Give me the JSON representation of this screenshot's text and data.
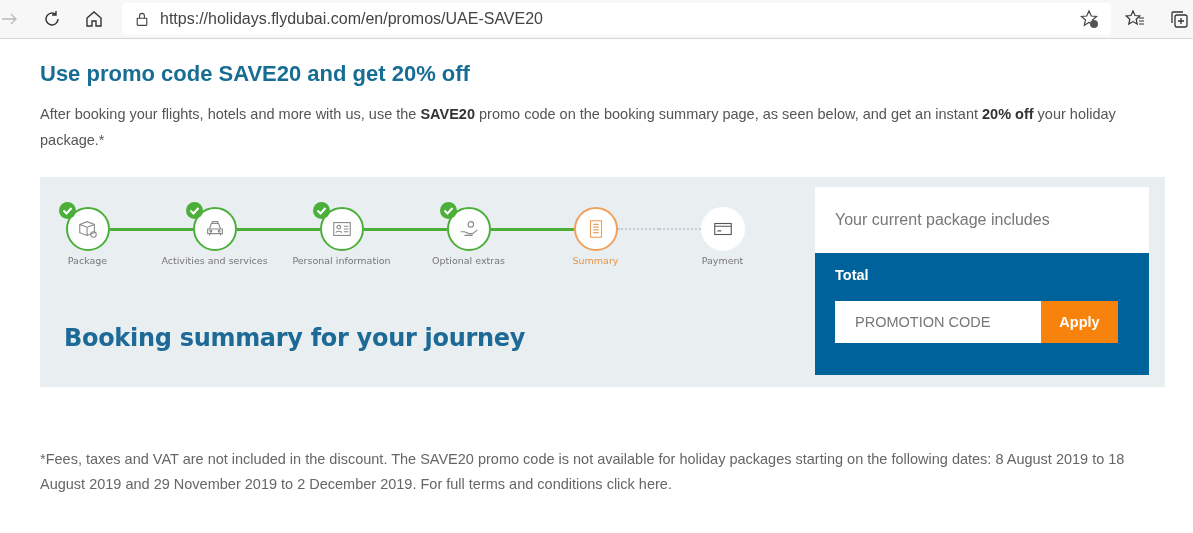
{
  "browser": {
    "url": "https://holidays.flydubai.com/en/promos/UAE-SAVE20"
  },
  "title": "Use promo code SAVE20 and get 20% off",
  "intro": "After booking your flights, hotels and more with us, use the **SAVE20** promo code on the booking summary page, as seen below, and get an instant **20% off** your holiday package.*",
  "illustration": {
    "steps": [
      {
        "label": "Package",
        "completed": true,
        "selected": false
      },
      {
        "label": "Activities and services",
        "completed": true,
        "selected": false
      },
      {
        "label": "Personal information",
        "completed": true,
        "selected": false
      },
      {
        "label": "Optional extras",
        "completed": true,
        "selected": false
      },
      {
        "label": "Summary",
        "completed": false,
        "selected": true
      },
      {
        "label": "Payment",
        "completed": false,
        "selected": false
      }
    ],
    "heading": "Booking summary for your journey",
    "package_card": {
      "title": "Your current package includes",
      "total_label": "Total",
      "promo_placeholder": "PROMOTION CODE",
      "apply_button": "Apply"
    }
  },
  "footnote": "*Fees, taxes and VAT are not included in the discount. The SAVE20 promo code is not available for holiday packages starting on the following dates: 8 August 2019 to 18 August 2019 and 29 November 2019 to 2 December 2019. For full terms and conditions click here."
}
